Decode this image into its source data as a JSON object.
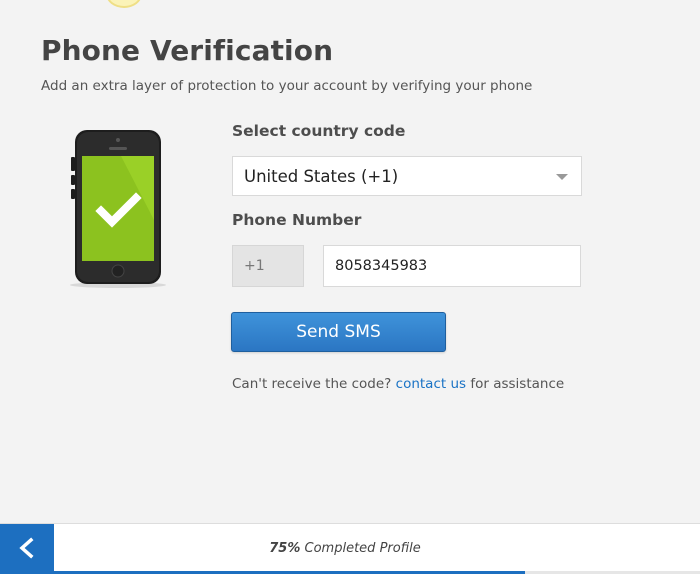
{
  "header": {
    "title": "Phone Verification",
    "subtitle": "Add an extra layer of protection to your account by verifying your phone"
  },
  "illustration": {
    "icon": "phone-check-icon",
    "screen_color": "#8cc21f"
  },
  "country": {
    "label": "Select country code",
    "selected": "United States (+1)"
  },
  "phone": {
    "label": "Phone Number",
    "prefix": "+1",
    "value": "8058345983"
  },
  "actions": {
    "send_label": "Send SMS"
  },
  "help": {
    "before": "Can't receive the code?",
    "link": "contact us",
    "after": "for assistance"
  },
  "footer": {
    "back_icon": "chevron-left-icon",
    "percent_text": "75%",
    "progress_label": "Completed Profile",
    "progress_fraction": 0.75
  },
  "colors": {
    "accent": "#1d6fc0",
    "link": "#1a73c5",
    "screen_green": "#8cc21f"
  }
}
